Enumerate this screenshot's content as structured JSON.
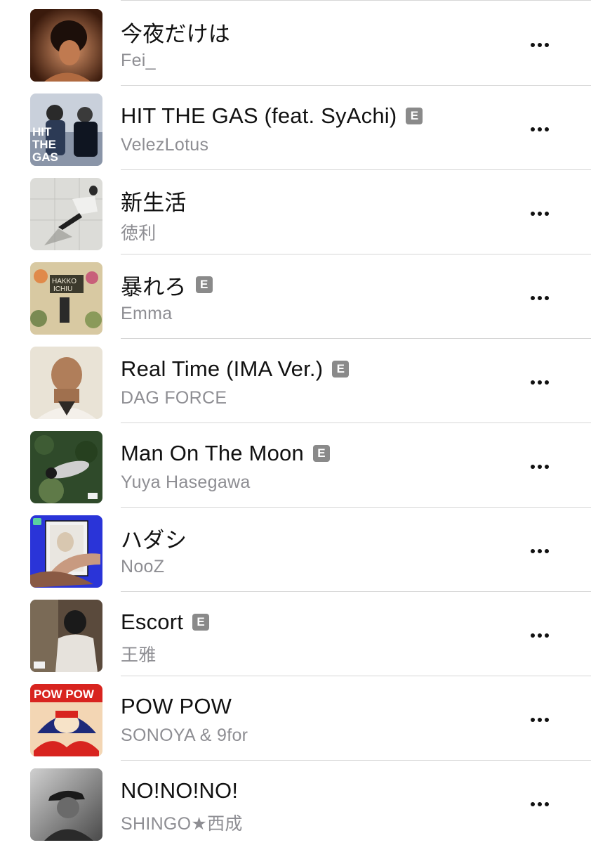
{
  "tracks": [
    {
      "title": "今夜だけは",
      "artist": "Fei_",
      "explicit": false,
      "artwork_colors": [
        "#7a3a1c",
        "#d9956a",
        "#1c0f0a"
      ]
    },
    {
      "title": "HIT THE GAS (feat. SyAchi)",
      "artist": "VelezLotus",
      "explicit": true,
      "artwork_colors": [
        "#2c3a55",
        "#c9d0db",
        "#0f1521"
      ],
      "artwork_text": "HIT THE GAS"
    },
    {
      "title": "新生活",
      "artist": "徳利",
      "explicit": false,
      "artwork_colors": [
        "#dcdcd8",
        "#b8b8b2",
        "#2a2a2a"
      ]
    },
    {
      "title": "暴れろ",
      "artist": "Emma",
      "explicit": true,
      "artwork_colors": [
        "#d8c9a2",
        "#7a8a52",
        "#3c3a2c"
      ],
      "artwork_text": "HAKKO ICHIU"
    },
    {
      "title": "Real Time (IMA Ver.)",
      "artist": "DAG FORCE",
      "explicit": true,
      "artwork_colors": [
        "#e9e3d6",
        "#b07e5a",
        "#2e2a26"
      ]
    },
    {
      "title": "Man On The Moon",
      "artist": "Yuya Hasegawa",
      "explicit": true,
      "artwork_colors": [
        "#2f4a2a",
        "#5f7a48",
        "#cfcfcf"
      ]
    },
    {
      "title": "ハダシ",
      "artist": "NooZ",
      "explicit": false,
      "artwork_colors": [
        "#2a34d8",
        "#d8c7b0",
        "#f2f2f2"
      ]
    },
    {
      "title": "Escort",
      "artist": "王雅",
      "explicit": true,
      "artwork_colors": [
        "#5a4a3c",
        "#e6e2dc",
        "#1a1a1a"
      ]
    },
    {
      "title": "POW POW",
      "artist": "SONOYA & 9for",
      "explicit": false,
      "artwork_colors": [
        "#d8241f",
        "#f3d6b4",
        "#1e2a7a"
      ],
      "artwork_text": "POW POW"
    },
    {
      "title": "NO!NO!NO!",
      "artist": "SHINGO★西成",
      "explicit": false,
      "artwork_colors": [
        "#8a8a8a",
        "#3a3a3a",
        "#d0d0d0"
      ]
    }
  ],
  "explicit_label": "E",
  "more_icon": "ellipsis-icon"
}
